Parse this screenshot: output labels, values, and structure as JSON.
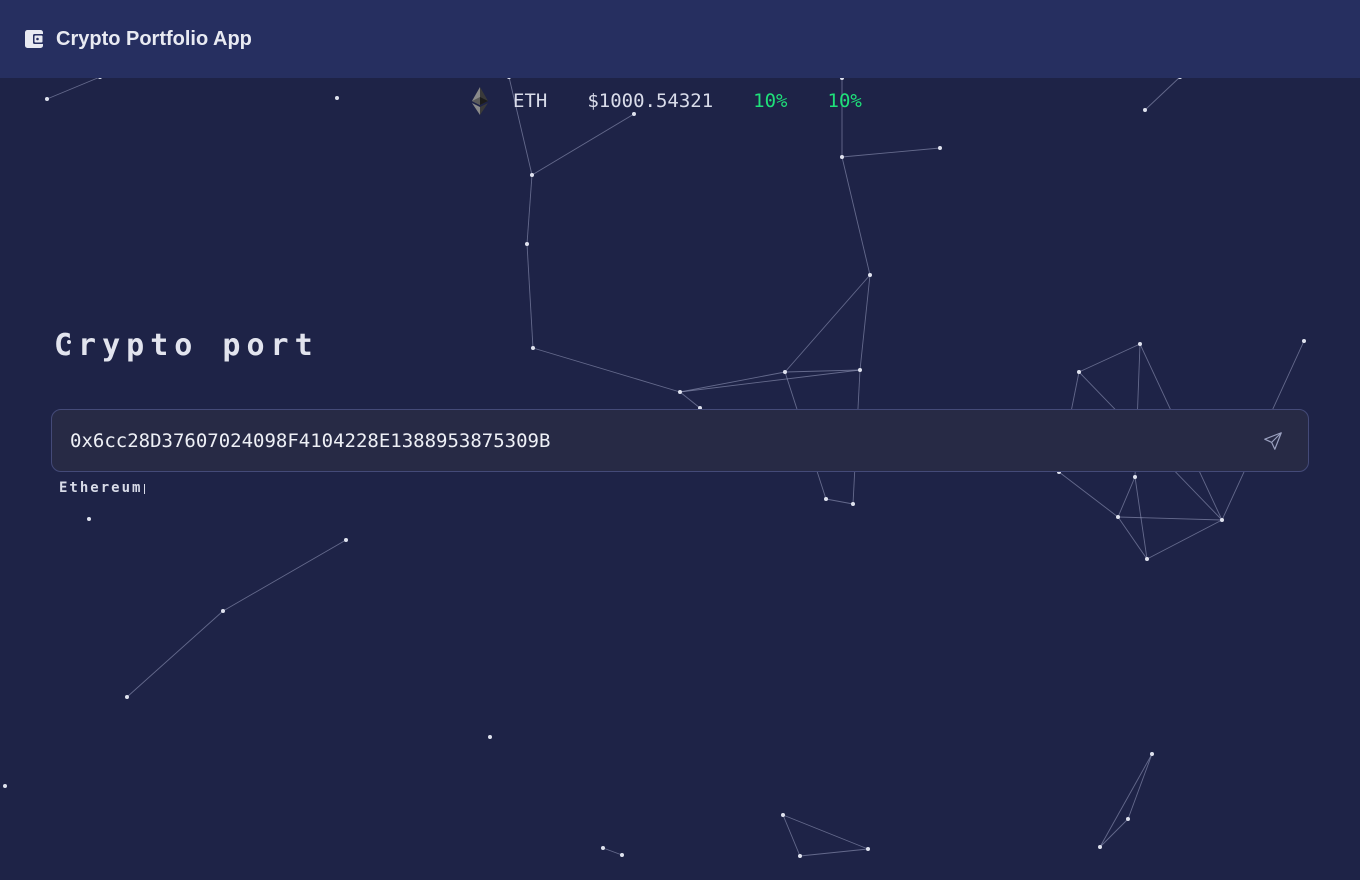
{
  "header": {
    "logo_icon": "wallet-icon",
    "title": "Crypto Portfolio App"
  },
  "ticker": {
    "icon": "ethereum-icon",
    "symbol": "ETH",
    "price": "$1000.54321",
    "change_1": "10%",
    "change_2": "10%",
    "positive_color": "#1fe07a"
  },
  "hero": {
    "title": "Crypto port"
  },
  "address_form": {
    "value": "0x6cc28D37607024098F4104228E1388953875309B",
    "submit_icon": "send-icon"
  },
  "network": {
    "label": "Ethereum"
  },
  "colors": {
    "background": "#1e2347",
    "header": "#262f60",
    "input_bg": "#272a45",
    "input_border": "#444a78"
  }
}
